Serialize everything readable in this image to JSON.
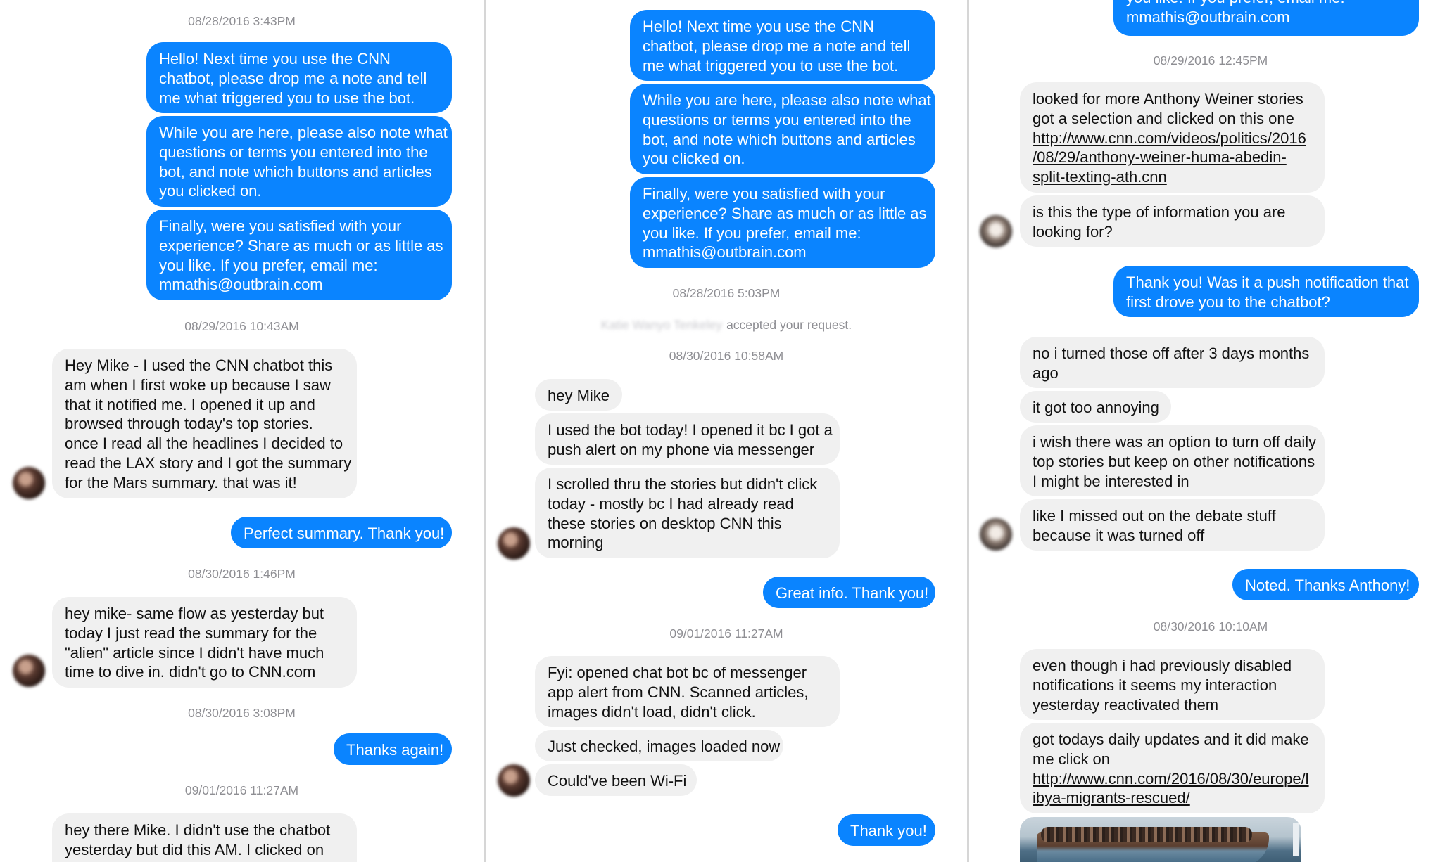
{
  "panel1": {
    "ts1": "08/28/2016 3:43PM",
    "m1": [
      "Hello! Next time you use the CNN",
      "chatbot, please drop me a note and tell",
      "me what triggered you to use the bot."
    ],
    "m2": [
      "While you are here, please also note what",
      "questions or terms you entered into the",
      "bot, and note which buttons and articles",
      "you clicked on."
    ],
    "m3": [
      "Finally, were you satisfied with your",
      "experience? Share as much or as little as",
      "you like. If you prefer, email me:",
      "mmathis@outbrain.com"
    ],
    "ts2": "08/29/2016 10:43AM",
    "r1": [
      "Hey Mike - I used the CNN chatbot this",
      "am when I first woke up because I saw",
      "that it notified me. I opened it up and",
      "browsed through today's top stories.",
      "once I read all the headlines I decided to",
      "read the LAX story and I got the summary",
      "for the Mars summary. that was it!"
    ],
    "m4": "Perfect summary. Thank you!",
    "ts3": "08/30/2016 1:46PM",
    "r2": [
      "hey mike- same flow as yesterday but",
      "today I just read the summary for the",
      "\"alien\" article since I didn't have much",
      "time to dive in. didn't go to CNN.com"
    ],
    "ts4": "08/30/2016 3:08PM",
    "m5": "Thanks again!",
    "ts5": "09/01/2016 11:27AM",
    "r3": [
      "hey there Mike. I didn't use the chatbot",
      "yesterday but did this AM. I clicked on"
    ]
  },
  "panel2": {
    "m1": [
      "Hello! Next time you use the CNN",
      "chatbot, please drop me a note and tell",
      "me what triggered you to use the bot."
    ],
    "m2": [
      "While you are here, please also note what",
      "questions or terms you entered into the",
      "bot, and note which buttons and articles",
      "you clicked on."
    ],
    "m3": [
      "Finally, were you satisfied with your",
      "experience? Share as much or as little as",
      "you like. If you prefer, email me:",
      "mmathis@outbrain.com"
    ],
    "ts1": "08/28/2016 5:03PM",
    "sys_name": "Katie Wanyo Tenkeley",
    "sys_text": "accepted your request.",
    "ts2": "08/30/2016 10:58AM",
    "r1": "hey Mike",
    "r2": [
      "I used the bot today! I opened it bc I got a",
      "push alert on my phone via messenger"
    ],
    "r3": [
      "I scrolled thru the stories but didn't click",
      "today - mostly bc I had already read",
      "these stories on desktop CNN this",
      "morning"
    ],
    "m4": "Great info. Thank you!",
    "ts3": "09/01/2016 11:27AM",
    "r4": [
      "Fyi: opened chat bot bc of messenger",
      "app alert from CNN. Scanned articles,",
      "images didn't load, didn't click."
    ],
    "r5": "Just checked, images loaded now",
    "r6": "Could've been Wi-Fi",
    "m5": "Thank you!"
  },
  "panel3": {
    "m1": [
      "you like. If you prefer, email me:",
      "mmathis@outbrain.com"
    ],
    "ts1": "08/29/2016 12:45PM",
    "r1": [
      "looked for more Anthony Weiner stories",
      "got a selection and clicked on this one"
    ],
    "r1_link": [
      "http://www.cnn.com/videos/politics/2016",
      "/08/29/anthony-weiner-huma-abedin-",
      "split-texting-ath.cnn"
    ],
    "r2": [
      "is this the type of information you are",
      "looking for?"
    ],
    "m2": [
      "Thank you! Was it a push notification that",
      "first drove you to the chatbot?"
    ],
    "r3": [
      "no i turned those off after 3 days months",
      "ago"
    ],
    "r4": "it got too annoying",
    "r5": [
      "i wish there was an option to turn off daily",
      "top stories but keep on other notifications",
      "I might be interested in"
    ],
    "r6": [
      "like I missed out on the debate stuff",
      "because it was turned off"
    ],
    "m3": "Noted. Thanks Anthony!",
    "ts2": "08/30/2016 10:10AM",
    "r7": [
      "even though i had previously disabled",
      "notifications it seems my interaction",
      "yesterday reactivated them"
    ],
    "r8": [
      "got todays daily updates and it did make",
      "me click on"
    ],
    "r8_link": [
      "http://www.cnn.com/2016/08/30/europe/l",
      "ibya-migrants-rescued/"
    ]
  }
}
